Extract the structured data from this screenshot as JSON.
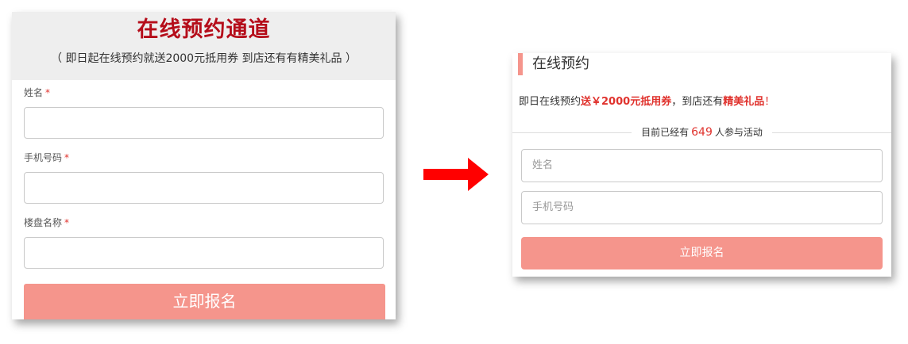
{
  "left_form": {
    "title": "在线预约通道",
    "subtitle": "（ 即日起在线预约就送2000元抵用券   到店还有有精美礼品 ）",
    "fields": [
      {
        "label": "姓名",
        "required_mark": "*",
        "value": ""
      },
      {
        "label": "手机号码",
        "required_mark": "*",
        "value": ""
      },
      {
        "label": "楼盘名称",
        "required_mark": "*",
        "value": ""
      }
    ],
    "submit_label": "立即报名"
  },
  "arrow": {
    "icon": "right-arrow-icon",
    "color": "#ff0000"
  },
  "right_form": {
    "title": "在线预约",
    "promo": {
      "part1": "即日在线预约",
      "highlight1": "送￥2000元抵用券",
      "part2": "，到店还有",
      "highlight2": "精美礼品",
      "part3": "！"
    },
    "participants": {
      "prefix": "目前已经有",
      "count": "649",
      "suffix": "人参与活动"
    },
    "name_placeholder": "姓名",
    "phone_placeholder": "手机号码",
    "submit_label": "立即报名"
  },
  "colors": {
    "accent_red": "#b50d1a",
    "highlight_red": "#e0322d",
    "button_pink": "#f5958c",
    "header_gray": "#eeeeee"
  }
}
